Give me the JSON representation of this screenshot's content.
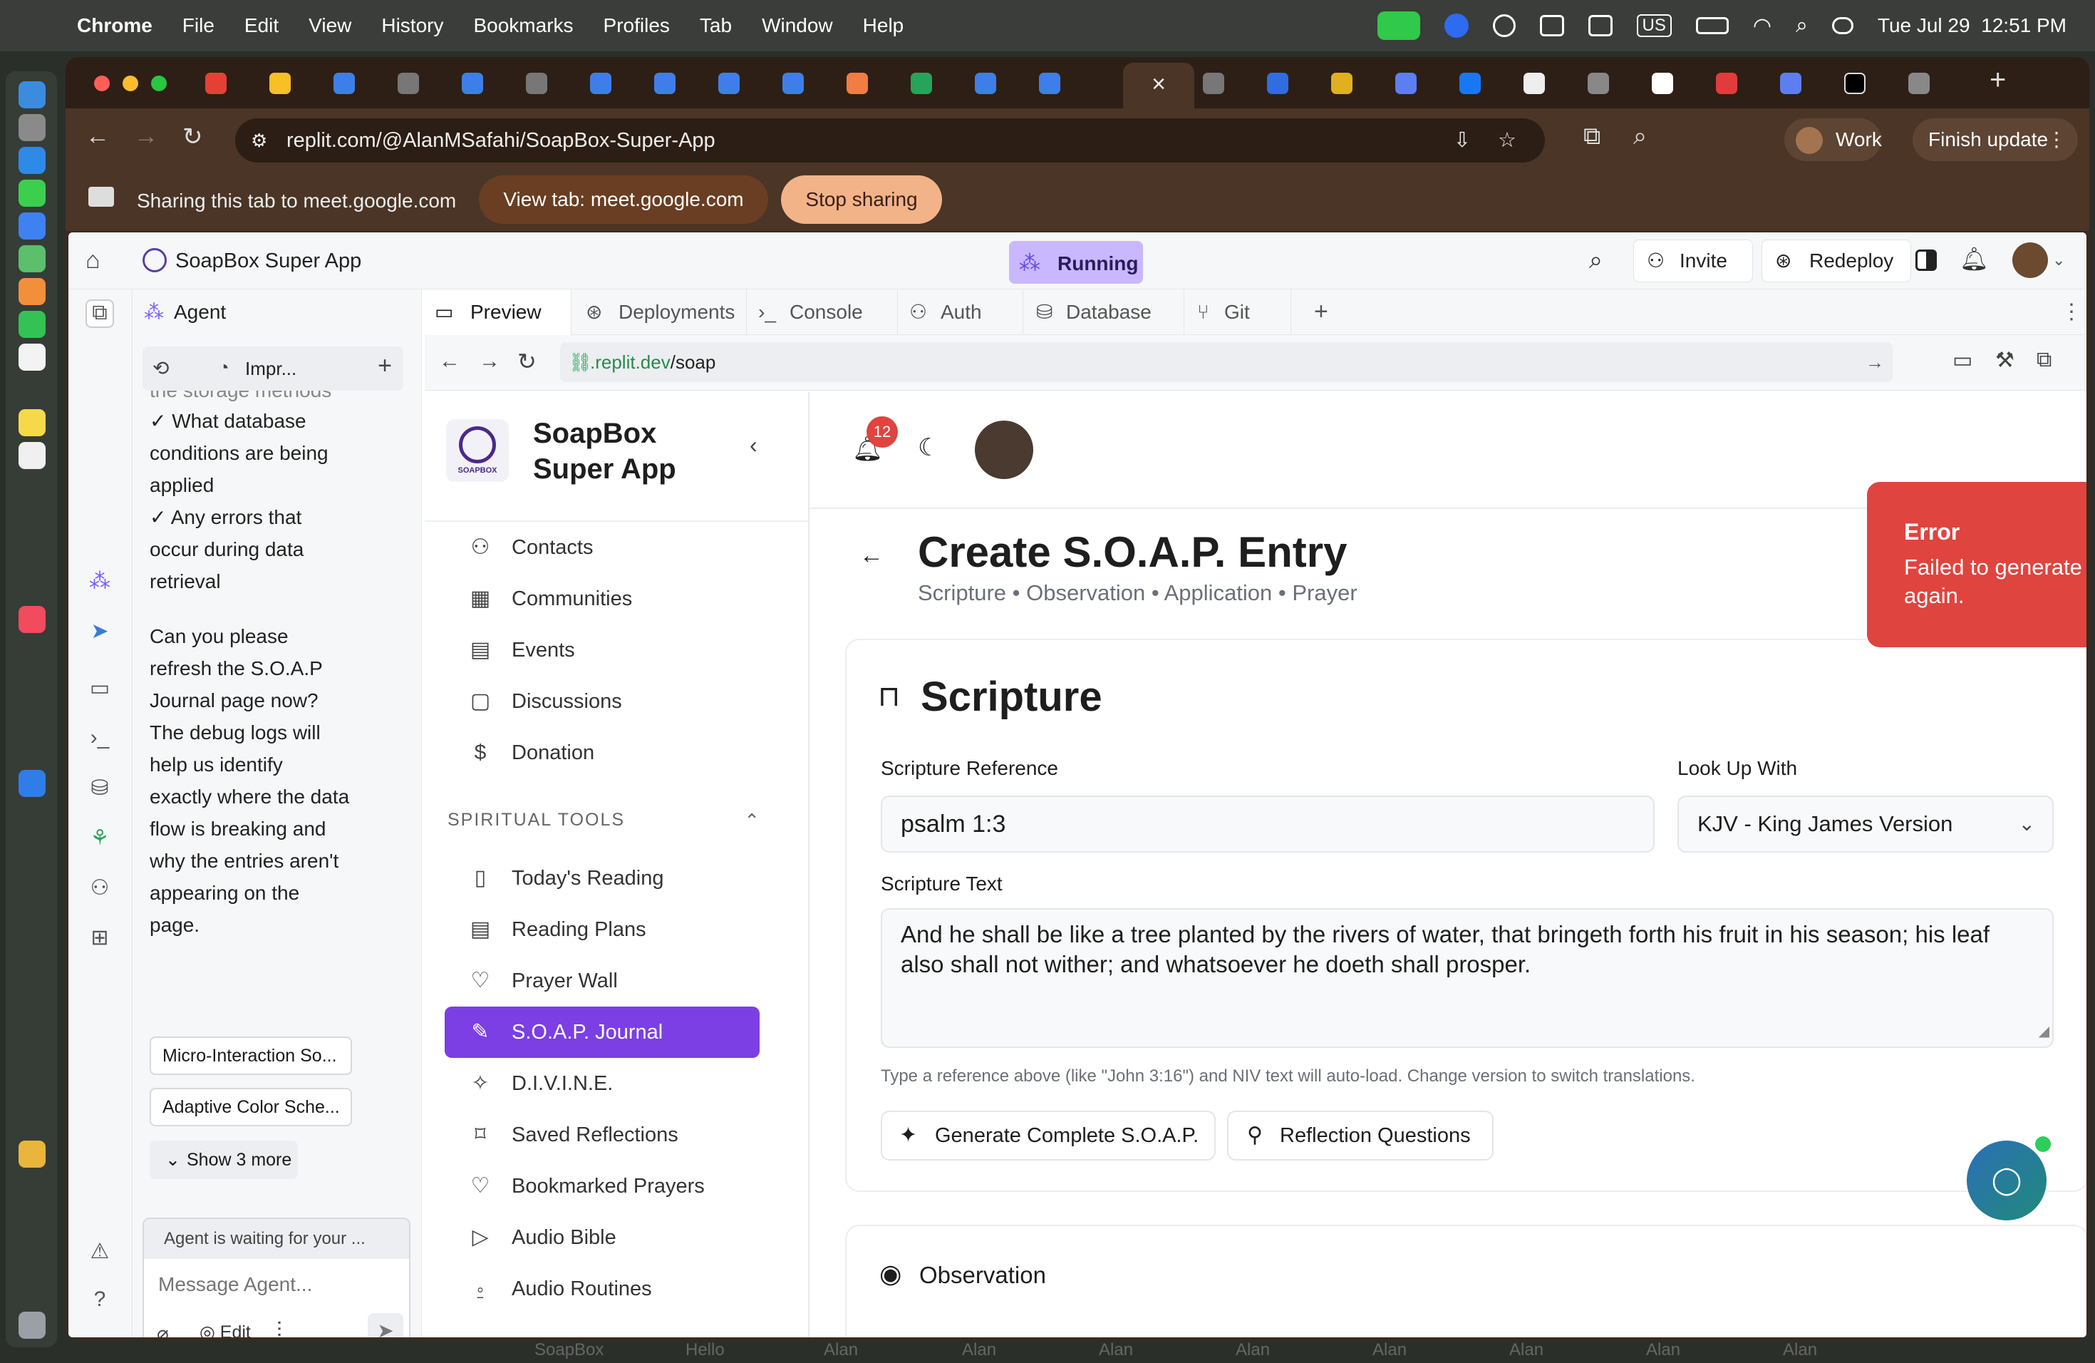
{
  "menubar": {
    "app": "Chrome",
    "items": [
      "File",
      "Edit",
      "View",
      "History",
      "Bookmarks",
      "Profiles",
      "Tab",
      "Window",
      "Help"
    ],
    "clock": "Tue Jul 29  12:51 PM",
    "input_source": "US"
  },
  "browser": {
    "url": "replit.com/@AlanMSafahi/SoapBox-Super-App",
    "profile": "Work",
    "finish_update": "Finish update",
    "active_tab_close": "×",
    "new_tab": "+"
  },
  "share_bar": {
    "text": "Sharing this tab to meet.google.com",
    "view_tab": "View tab: meet.google.com",
    "stop": "Stop sharing"
  },
  "replit": {
    "project": "SoapBox Super App",
    "status": "Running",
    "invite": "Invite",
    "redeploy": "Redeploy",
    "tabs": [
      "Preview",
      "Deployments",
      "Console",
      "Auth",
      "Database",
      "Git"
    ],
    "agent_tab": "Agent",
    "preview_url_prefix": ".replit.dev",
    "preview_url_path": "/soap"
  },
  "agent": {
    "session_label": "Impr...",
    "cut_line": "the storage methods",
    "message1": [
      "✓ What database",
      "conditions are being",
      "applied",
      "✓ Any errors that",
      "occur during data",
      "retrieval"
    ],
    "message2": [
      "Can you please",
      "refresh the S.O.A.P",
      "Journal page now?",
      "The debug logs will",
      "help us identify",
      "exactly where the data",
      "flow is breaking and",
      "why the entries aren't",
      "appearing on the",
      "page."
    ],
    "chips": [
      "Micro-Interaction So...",
      "Adaptive Color Sche..."
    ],
    "show_more": "Show 3 more",
    "waiting": "Agent is waiting for your ...",
    "placeholder": "Message Agent...",
    "edit": "Edit"
  },
  "app": {
    "logo_text": "SOAPBOX",
    "title_line1": "SoapBox",
    "title_line2": "Super App",
    "notif_count": "12",
    "nav": [
      {
        "label": "Contacts",
        "icon": "contacts-icon"
      },
      {
        "label": "Communities",
        "icon": "building-icon"
      },
      {
        "label": "Events",
        "icon": "calendar-icon"
      },
      {
        "label": "Discussions",
        "icon": "chat-icon"
      },
      {
        "label": "Donation",
        "icon": "dollar-icon"
      }
    ],
    "section": "SPIRITUAL TOOLS",
    "tools": [
      {
        "label": "Today's Reading",
        "icon": "book-icon"
      },
      {
        "label": "Reading Plans",
        "icon": "calendar-icon"
      },
      {
        "label": "Prayer Wall",
        "icon": "heart-icon"
      },
      {
        "label": "S.O.A.P. Journal",
        "icon": "pen-icon",
        "active": true
      },
      {
        "label": "D.I.V.I.N.E.",
        "icon": "sparkle-icon"
      },
      {
        "label": "Saved Reflections",
        "icon": "bookmark-icon"
      },
      {
        "label": "Bookmarked Prayers",
        "icon": "heart-icon"
      },
      {
        "label": "Audio Bible",
        "icon": "play-icon"
      },
      {
        "label": "Audio Routines",
        "icon": "mic-icon"
      }
    ]
  },
  "soap": {
    "title": "Create S.O.A.P. Entry",
    "subtitle": "Scripture • Observation • Application • Prayer",
    "scripture_heading": "Scripture",
    "ref_label": "Scripture Reference",
    "ref_value": "psalm 1:3",
    "version_label": "Look Up With",
    "version_value": "KJV - King James Version",
    "text_label": "Scripture Text",
    "text_value": "And he shall be like a tree planted by the rivers of water, that bringeth forth his fruit in his season; his leaf also shall not wither; and whatsoever he doeth shall prosper.",
    "hint": "Type a reference above (like \"John 3:16\") and NIV text will auto-load. Change version to switch translations.",
    "btn_generate": "Generate Complete S.O.A.P.",
    "btn_reflect": "Reflection Questions",
    "observation_heading": "Observation"
  },
  "toast": {
    "title": "Error",
    "message": "Failed to generate AI suggestions. Please try again."
  },
  "taskbar": [
    "SoapBox",
    "Hello",
    "Alan",
    "Alan",
    "Alan",
    "Alan",
    "Alan",
    "Alan",
    "Alan",
    "Alan"
  ],
  "colors": {
    "accent": "#7b3fe4",
    "error": "#e0443f",
    "running": "#c9b8ff"
  }
}
